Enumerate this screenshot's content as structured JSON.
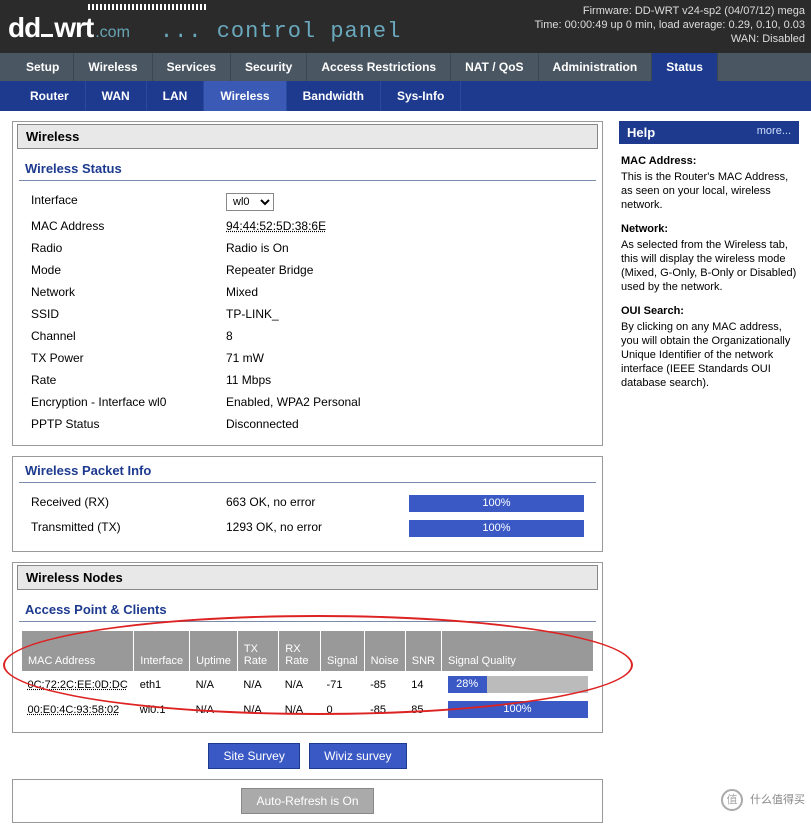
{
  "header": {
    "firmware": "Firmware: DD-WRT v24-sp2 (04/07/12) mega",
    "time": "Time: 00:00:49 up 0 min, load average: 0.29, 0.10, 0.03",
    "wan": "WAN: Disabled",
    "control_panel": "... control panel"
  },
  "main_tabs": [
    "Setup",
    "Wireless",
    "Services",
    "Security",
    "Access Restrictions",
    "NAT / QoS",
    "Administration",
    "Status"
  ],
  "main_tab_active": 7,
  "sub_tabs": [
    "Router",
    "WAN",
    "LAN",
    "Wireless",
    "Bandwidth",
    "Sys-Info"
  ],
  "sub_tab_active": 3,
  "wireless": {
    "section_title": "Wireless",
    "status_head": "Wireless Status",
    "fields": {
      "interface_label": "Interface",
      "interface_value": "wl0",
      "mac_label": "MAC Address",
      "mac_value": "94:44:52:5D:38:6E",
      "radio_label": "Radio",
      "radio_value": "Radio is On",
      "mode_label": "Mode",
      "mode_value": "Repeater Bridge",
      "network_label": "Network",
      "network_value": "Mixed",
      "ssid_label": "SSID",
      "ssid_value": "TP-LINK_",
      "channel_label": "Channel",
      "channel_value": "8",
      "tx_label": "TX Power",
      "tx_value": "71 mW",
      "rate_label": "Rate",
      "rate_value": "11 Mbps",
      "enc_label": "Encryption - Interface wl0",
      "enc_value": "Enabled, WPA2 Personal",
      "pptp_label": "PPTP Status",
      "pptp_value": "Disconnected"
    }
  },
  "packet": {
    "head": "Wireless Packet Info",
    "rx_label": "Received (RX)",
    "rx_value": "663 OK, no error",
    "rx_pct": "100%",
    "tx_label": "Transmitted (TX)",
    "tx_value": "1293 OK, no error",
    "tx_pct": "100%"
  },
  "nodes": {
    "section_title": "Wireless Nodes",
    "head": "Access Point & Clients",
    "cols": [
      "MAC Address",
      "Interface",
      "Uptime",
      "TX Rate",
      "RX Rate",
      "Signal",
      "Noise",
      "SNR",
      "Signal Quality"
    ],
    "rows": [
      {
        "mac": "0C:72:2C:EE:0D:DC",
        "if": "eth1",
        "up": "N/A",
        "txr": "N/A",
        "rxr": "N/A",
        "sig": "-71",
        "noise": "-85",
        "snr": "14",
        "sq": "28%",
        "sq_w": 28
      },
      {
        "mac": "00:E0:4C:93:58:02",
        "if": "wl0.1",
        "up": "N/A",
        "txr": "N/A",
        "rxr": "N/A",
        "sig": "0",
        "noise": "-85",
        "snr": "85",
        "sq": "100%",
        "sq_w": 100
      }
    ]
  },
  "buttons": {
    "survey": "Site Survey",
    "wiviz": "Wiviz survey",
    "auto": "Auto-Refresh is On"
  },
  "help": {
    "title": "Help",
    "more": "more...",
    "mac_h": "MAC Address:",
    "mac_t": "This is the Router's MAC Address, as seen on your local, wireless network.",
    "net_h": "Network:",
    "net_t": "As selected from the Wireless tab, this will display the wireless mode (Mixed, G-Only, B-Only or Disabled) used by the network.",
    "oui_h": "OUI Search:",
    "oui_t": "By clicking on any MAC address, you will obtain the Organizationally Unique Identifier of the network interface (IEEE Standards OUI database search)."
  },
  "watermark": "什么值得买"
}
